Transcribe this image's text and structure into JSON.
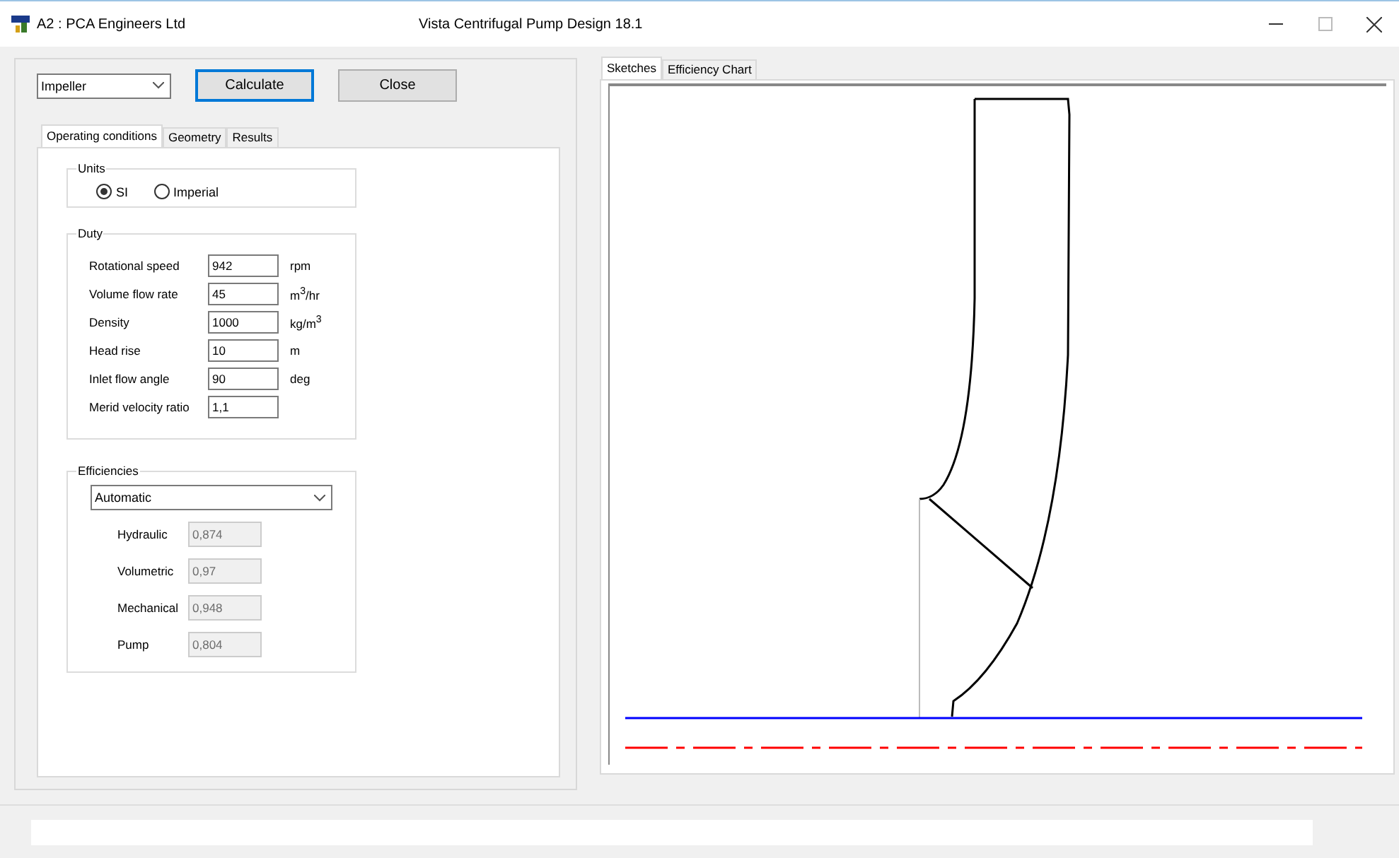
{
  "window": {
    "app_title": "A2 : PCA Engineers Ltd",
    "title": "Vista Centrifugal Pump Design 18.1"
  },
  "component_select": {
    "value": "Impeller"
  },
  "buttons": [
    {
      "label": "Calculate",
      "focused": true
    },
    {
      "label": "Close",
      "focused": false
    }
  ],
  "tabs": [
    {
      "label": "Operating conditions",
      "selected": true
    },
    {
      "label": "Geometry",
      "selected": false
    },
    {
      "label": "Results",
      "selected": false
    }
  ],
  "units": {
    "title": "Units",
    "options": [
      {
        "label": "SI",
        "selected": true
      },
      {
        "label": "Imperial",
        "selected": false
      }
    ]
  },
  "duty": {
    "title": "Duty",
    "rows": [
      {
        "label": "Rotational speed",
        "value": "942",
        "unit": "rpm"
      },
      {
        "label": "Volume flow rate",
        "value": "45",
        "unit": "m$^{3}$/hr"
      },
      {
        "label": "Density",
        "value": "1000",
        "unit": "kg/m$^{3}$"
      },
      {
        "label": "Head rise",
        "value": "10",
        "unit": "m"
      },
      {
        "label": "Inlet flow angle",
        "value": "90",
        "unit": "deg"
      },
      {
        "label": "Merid velocity ratio",
        "value": "1,1"
      }
    ]
  },
  "efficiencies": {
    "title": "Efficiencies",
    "mode": "Automatic",
    "rows": [
      {
        "label": "Hydraulic",
        "value": "0,874",
        "disabled": true
      },
      {
        "label": "Volumetric",
        "value": "0,97",
        "disabled": true
      },
      {
        "label": "Mechanical",
        "value": "0,948",
        "disabled": true
      },
      {
        "label": "Pump",
        "value": "0,804",
        "disabled": true
      }
    ]
  },
  "sketch_tabs": [
    {
      "label": "Sketches",
      "selected": true
    },
    {
      "label": "Efficiency Chart",
      "selected": false
    }
  ]
}
